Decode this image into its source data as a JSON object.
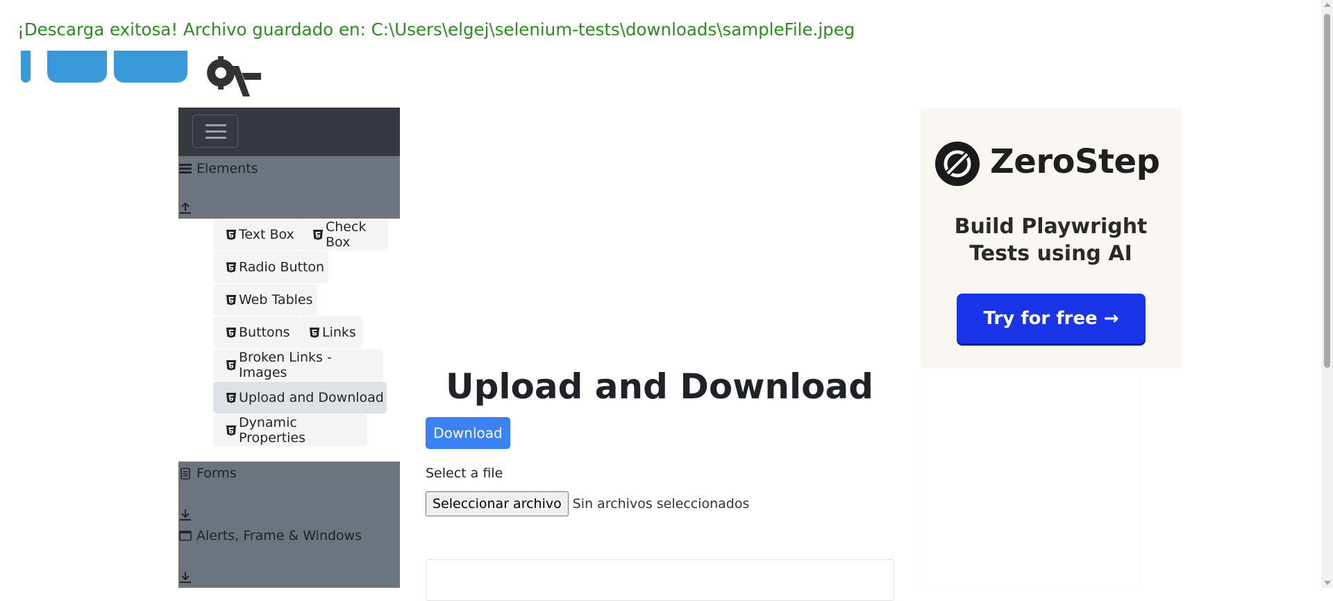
{
  "banner": {
    "message": "¡Descarga exitosa! Archivo guardado en: C:\\Users\\elgej\\selenium-tests\\downloads\\sampleFile.jpeg",
    "color": "#2e8b22"
  },
  "sidebar": {
    "groups": [
      {
        "label": "Elements",
        "icon": "list-icon"
      },
      {
        "label": "Forms",
        "icon": "document-icon"
      },
      {
        "label": "Alerts, Frame & Windows",
        "icon": "window-icon"
      }
    ],
    "items": [
      {
        "label": "Text Box"
      },
      {
        "label": "Check Box"
      },
      {
        "label": "Radio Button"
      },
      {
        "label": "Web Tables"
      },
      {
        "label": "Buttons"
      },
      {
        "label": "Links"
      },
      {
        "label": "Broken Links - Images"
      },
      {
        "label": "Upload and Download",
        "active": true
      },
      {
        "label": "Dynamic Properties"
      }
    ]
  },
  "main": {
    "title": "Upload and Download",
    "download_label": "Download",
    "select_label": "Select a file",
    "file_button_label": "Seleccionar archivo",
    "file_status": "Sin archivos seleccionados"
  },
  "ad": {
    "brand": "ZeroStep",
    "tagline_line1": "Build Playwright",
    "tagline_line2": "Tests using AI",
    "cta": "Try for free →",
    "cta_color": "#1a35e8"
  }
}
